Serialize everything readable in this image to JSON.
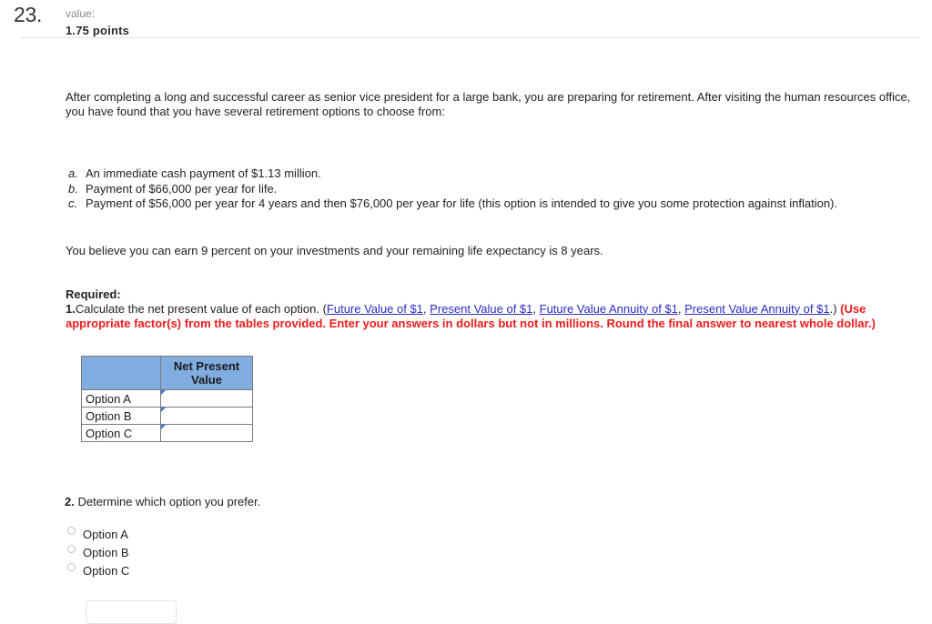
{
  "header": {
    "question_number": "23.",
    "value_label": "value:",
    "points": "1.75 points"
  },
  "intro": {
    "paragraph": "After completing a long and successful career as senior vice president for a large bank, you are preparing for retirement. After visiting the human resources office, you have found that you have several retirement options to choose from:"
  },
  "options": [
    {
      "marker": "a.",
      "text": "An immediate cash payment of $1.13 million."
    },
    {
      "marker": "b.",
      "text": "Payment of $66,000 per year for life."
    },
    {
      "marker": "c.",
      "text": "Payment of $56,000 per year for 4 years and then $76,000 per year for life (this option is intended to give you some protection against inflation)."
    }
  ],
  "assumption": {
    "text": "You believe you can earn 9 percent on your investments and your remaining life expectancy is 8 years."
  },
  "required": {
    "heading": "Required:",
    "item1_number": "1.",
    "item1_text": "Calculate the net present value of each option. (",
    "links": [
      "Future Value of $1",
      "Present Value of $1",
      "Future Value Annuity of $1",
      "Present Value Annuity of $1"
    ],
    "link_separator": ", ",
    "close_paren": ".) ",
    "red_instruction": "(Use appropriate factor(s) from the tables provided. Enter your answers in dollars but not in millions. Round the final answer to nearest whole dollar.)"
  },
  "npv_table": {
    "header_blank": "",
    "header_value": "Net Present Value",
    "rows": [
      {
        "label": "Option A",
        "value": ""
      },
      {
        "label": "Option B",
        "value": ""
      },
      {
        "label": "Option C",
        "value": ""
      }
    ]
  },
  "part2": {
    "number": "2.",
    "text": "Determine which option you prefer.",
    "choices": [
      {
        "label": "Option A",
        "selected": false
      },
      {
        "label": "Option B",
        "selected": false
      },
      {
        "label": "Option C",
        "selected": false
      }
    ]
  },
  "bottom_button": {
    "label": ""
  },
  "colors": {
    "table_header_blue": "#80ace0",
    "link_blue": "#2b2bc4",
    "instruction_red": "#ee1c1c",
    "cell_flag_blue": "#3f7fd0"
  }
}
